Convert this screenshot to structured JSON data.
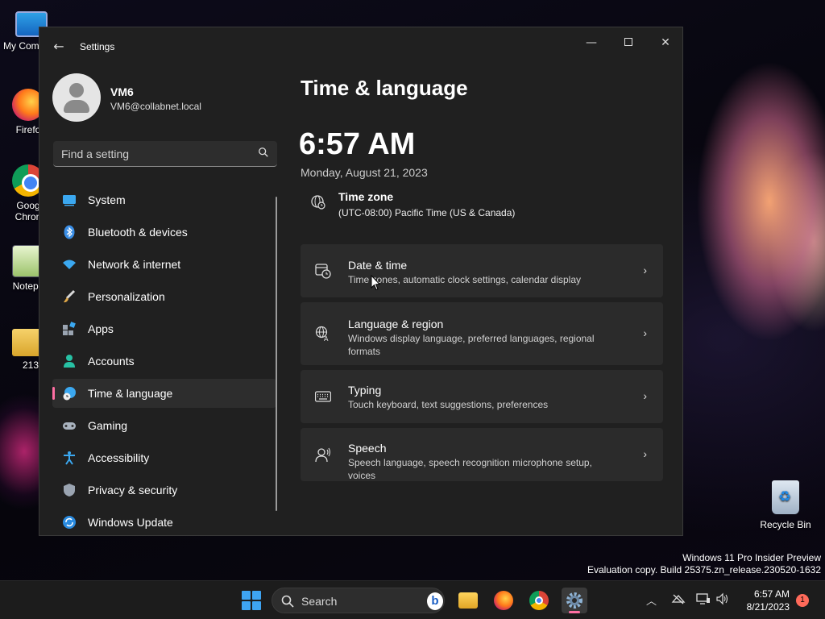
{
  "desktop": {
    "icons": [
      {
        "label": "My Com"
      },
      {
        "label": "Firefo"
      },
      {
        "label": "Goog\nChron"
      },
      {
        "label": "Notepa"
      },
      {
        "label": "213"
      }
    ],
    "recycle_bin": {
      "label": "Recycle Bin"
    },
    "watermark": {
      "line1": "Windows 11 Pro Insider Preview",
      "line2": "Evaluation copy. Build 25375.zn_release.230520-1632"
    }
  },
  "window": {
    "title": "Settings",
    "back_glyph": "←",
    "controls": {
      "minimize": "—",
      "close": "✕"
    }
  },
  "profile": {
    "name": "VM6",
    "email": "VM6@collabnet.local"
  },
  "search": {
    "placeholder": "Find a setting"
  },
  "sidebar": {
    "items": [
      {
        "label": "System",
        "icon": "system-icon",
        "active": false
      },
      {
        "label": "Bluetooth & devices",
        "icon": "bluetooth-icon",
        "active": false
      },
      {
        "label": "Network & internet",
        "icon": "wifi-icon",
        "active": false
      },
      {
        "label": "Personalization",
        "icon": "brush-icon",
        "active": false
      },
      {
        "label": "Apps",
        "icon": "apps-icon",
        "active": false
      },
      {
        "label": "Accounts",
        "icon": "accounts-icon",
        "active": false
      },
      {
        "label": "Time & language",
        "icon": "time-language-icon",
        "active": true
      },
      {
        "label": "Gaming",
        "icon": "gamepad-icon",
        "active": false
      },
      {
        "label": "Accessibility",
        "icon": "accessibility-icon",
        "active": false
      },
      {
        "label": "Privacy & security",
        "icon": "shield-icon",
        "active": false
      },
      {
        "label": "Windows Update",
        "icon": "update-icon",
        "active": false
      }
    ]
  },
  "main": {
    "title": "Time & language",
    "clock": "6:57 AM",
    "date": "Monday, August 21, 2023",
    "timezone": {
      "label": "Time zone",
      "value": "(UTC-08:00) Pacific Time (US & Canada)"
    },
    "cards": [
      {
        "title": "Date & time",
        "desc": "Time zones, automatic clock settings, calendar display",
        "icon": "calendar-clock-icon"
      },
      {
        "title": "Language & region",
        "desc": "Windows display language, preferred languages, regional formats",
        "icon": "language-icon"
      },
      {
        "title": "Typing",
        "desc": "Touch keyboard, text suggestions, preferences",
        "icon": "keyboard-icon"
      },
      {
        "title": "Speech",
        "desc": "Speech language, speech recognition microphone setup, voices",
        "icon": "speech-icon"
      }
    ],
    "chevron": "›"
  },
  "taskbar": {
    "search_label": "Search",
    "bing_glyph": "b",
    "time": "6:57 AM",
    "date": "8/21/2023",
    "notification_count": "1",
    "tray_chevron": "︿"
  },
  "colors": {
    "accent": "#ff6fa3",
    "window_bg": "#202020",
    "card_bg": "#2b2b2b",
    "start_blue": "#3ea4f2"
  }
}
